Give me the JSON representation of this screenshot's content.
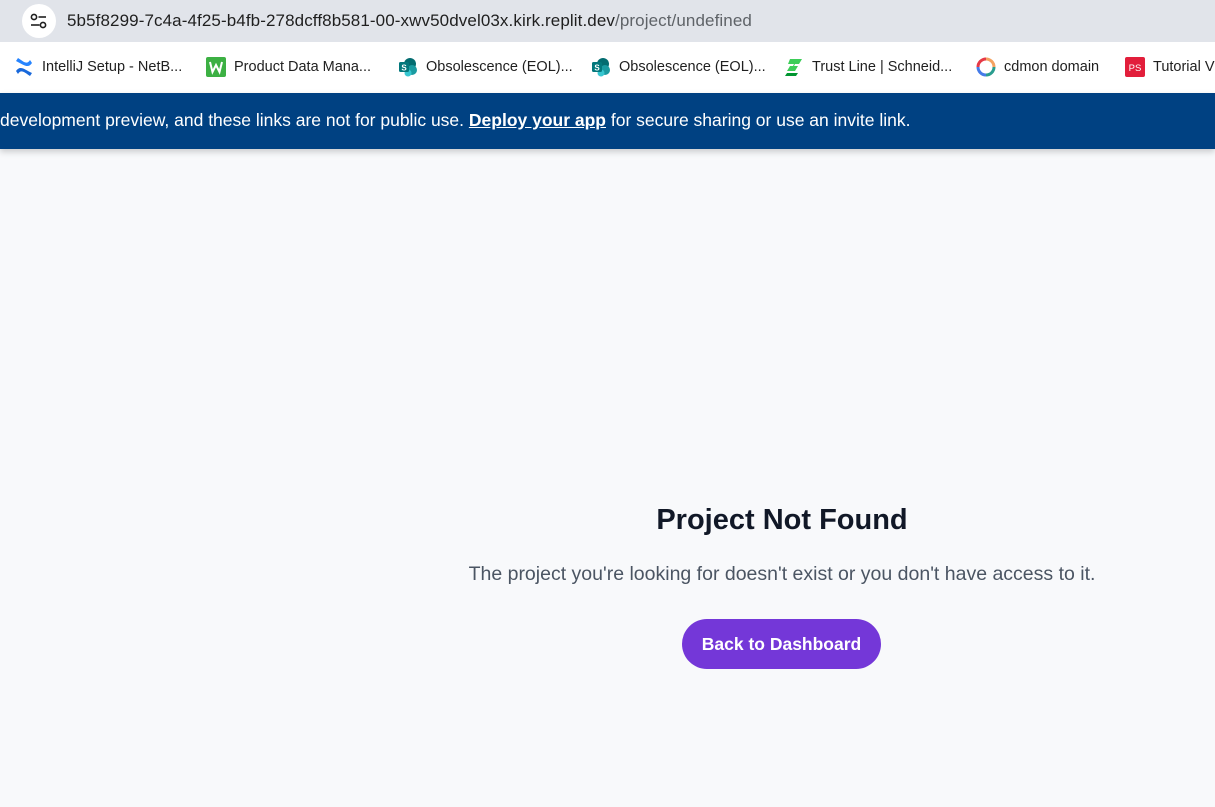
{
  "browser": {
    "url_host": "5b5f8299-7c4a-4f25-b4fb-278dcff8b581-00-xwv50dvel03x.kirk.replit.dev",
    "url_path": "/project/undefined",
    "site_info_icon": "tune-icon"
  },
  "bookmarks": [
    {
      "label": "IntelliJ Setup - NetB...",
      "icon": "confluence-icon",
      "color": "#1868db"
    },
    {
      "label": "Product Data Mana...",
      "icon": "w-icon",
      "color": "#3cb043"
    },
    {
      "label": "Obsolescence (EOL)...",
      "icon": "sharepoint-icon",
      "color": "#037f83"
    },
    {
      "label": "Obsolescence (EOL)...",
      "icon": "sharepoint-icon",
      "color": "#037f83"
    },
    {
      "label": "Trust Line | Schneid...",
      "icon": "schneider-icon",
      "color": "#3dcd58"
    },
    {
      "label": "cdmon domain",
      "icon": "cdmon-icon",
      "color": "#e63946"
    },
    {
      "label": "Tutorial V",
      "icon": "ps-icon",
      "color": "#e21e3b"
    }
  ],
  "banner": {
    "text_before": "development preview, and these links are not for public use. ",
    "link": "Deploy your app",
    "text_after": " for secure sharing or use an invite link.",
    "background": "#004182"
  },
  "main": {
    "title": "Project Not Found",
    "description": "The project you're looking for doesn't exist or you don't have access to it.",
    "button_label": "Back to Dashboard",
    "button_color": "#7437d8"
  }
}
